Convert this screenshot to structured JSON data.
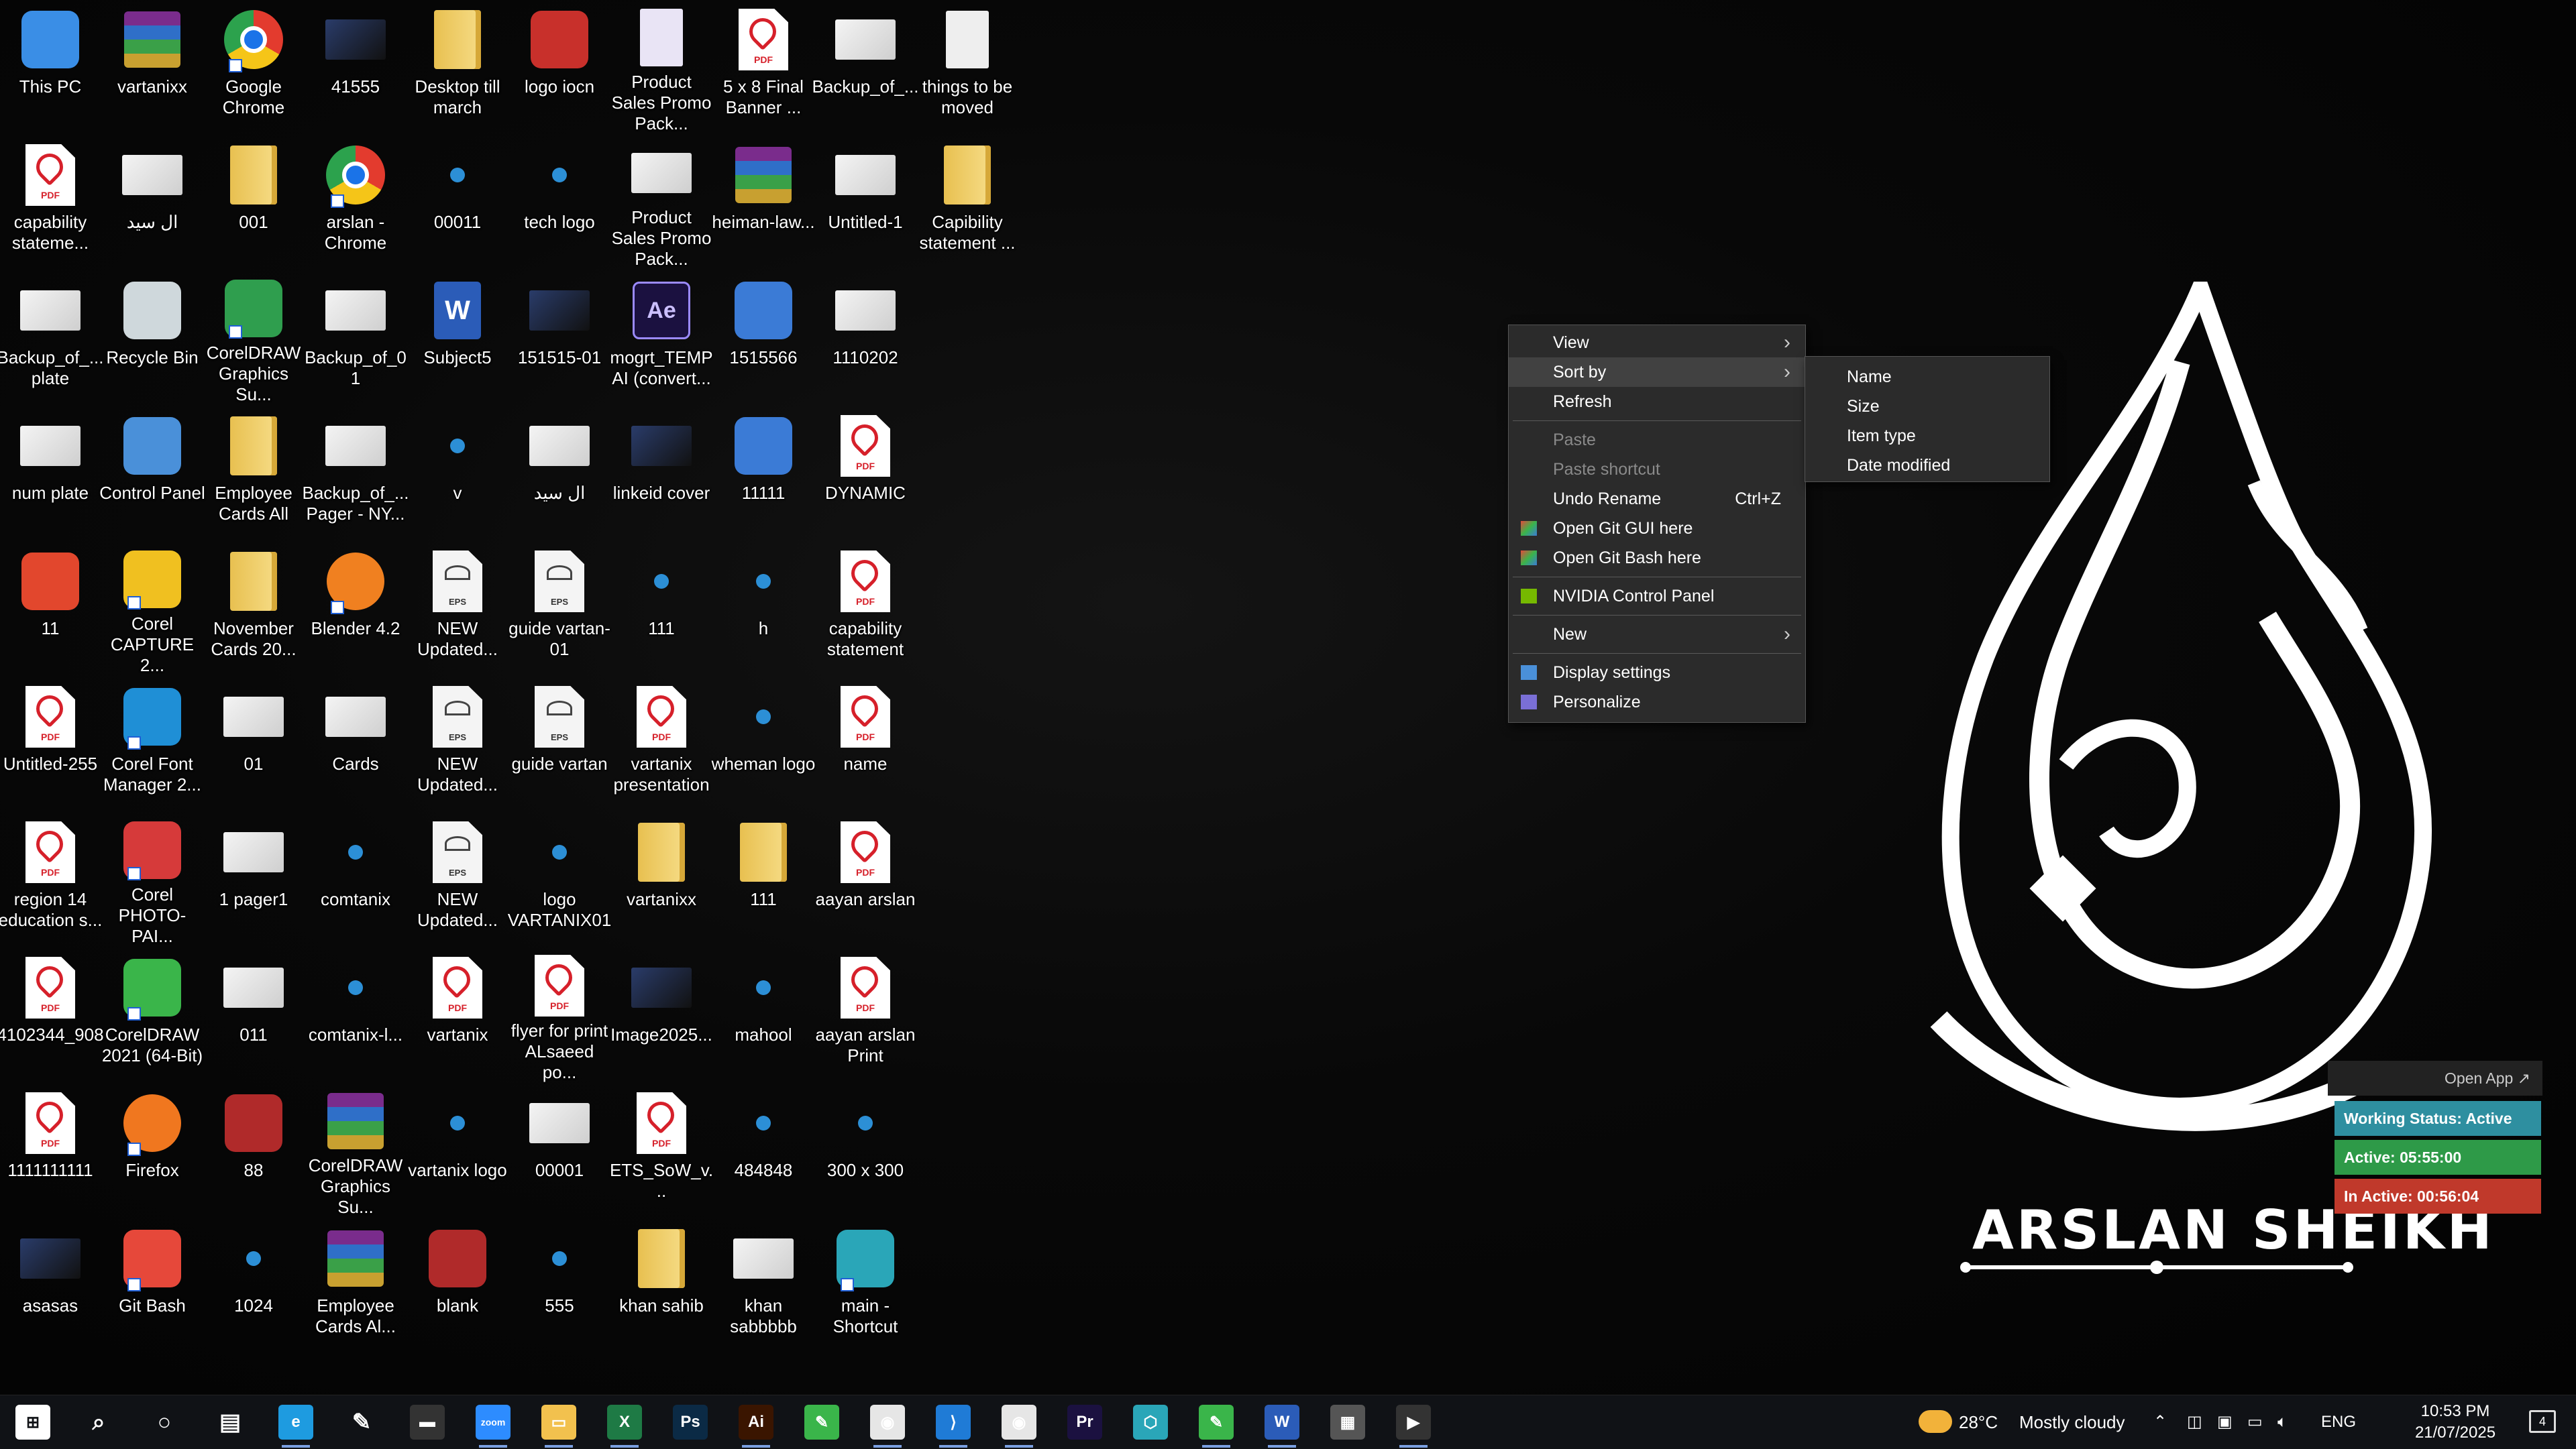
{
  "desktop_icons": [
    {
      "label": "This PC",
      "kind": "pc"
    },
    {
      "label": "vartanixx",
      "kind": "rar"
    },
    {
      "label": "Google Chrome",
      "kind": "chrome",
      "shortcut": true
    },
    {
      "label": "41555",
      "kind": "imgdark"
    },
    {
      "label": "Desktop till march",
      "kind": "folder"
    },
    {
      "label": "logo iocn",
      "kind": "logo"
    },
    {
      "label": "Product Sales Promo Pack...",
      "kind": "doc"
    },
    {
      "label": "5 x 8 Final Banner ...",
      "kind": "pdf"
    },
    {
      "label": "Backup_of_...",
      "kind": "img"
    },
    {
      "label": "things to be moved",
      "kind": "blank"
    },
    {
      "label": "capability stateme...",
      "kind": "pdf"
    },
    {
      "label": "ال سيد",
      "kind": "img"
    },
    {
      "label": "001",
      "kind": "folder"
    },
    {
      "label": "arslan - Chrome",
      "kind": "chrome",
      "shortcut": true
    },
    {
      "label": "00011",
      "kind": "small"
    },
    {
      "label": "tech logo",
      "kind": "small"
    },
    {
      "label": "Product Sales Promo Pack...",
      "kind": "img"
    },
    {
      "label": "heiman-law...",
      "kind": "rar"
    },
    {
      "label": "Untitled-1",
      "kind": "img"
    },
    {
      "label": "Capibility statement ...",
      "kind": "folder"
    },
    {
      "label": "Backup_of_... plate",
      "kind": "img"
    },
    {
      "label": "Recycle Bin",
      "kind": "bin"
    },
    {
      "label": "CorelDRAW Graphics Su...",
      "kind": "corel",
      "shortcut": true
    },
    {
      "label": "Backup_of_01",
      "kind": "img"
    },
    {
      "label": "Subject5",
      "kind": "word"
    },
    {
      "label": "151515-01",
      "kind": "imgdark"
    },
    {
      "label": "mogrt_TEMP AI (convert...",
      "kind": "ae"
    },
    {
      "label": "1515566",
      "kind": "scale"
    },
    {
      "label": "1110202",
      "kind": "img"
    },
    {
      "label": "num plate",
      "kind": "img"
    },
    {
      "label": "Control Panel",
      "kind": "cpanel"
    },
    {
      "label": "Employee Cards All",
      "kind": "folder"
    },
    {
      "label": "Backup_of_... Pager - NY...",
      "kind": "img"
    },
    {
      "label": "v",
      "kind": "small"
    },
    {
      "label": "ال سيد",
      "kind": "img"
    },
    {
      "label": "linkeid cover",
      "kind": "imgdark"
    },
    {
      "label": "11111",
      "kind": "scale"
    },
    {
      "label": "DYNAMIC",
      "kind": "pdf"
    },
    {
      "label": "11",
      "kind": "dots"
    },
    {
      "label": "Corel CAPTURE 2...",
      "kind": "capture",
      "shortcut": true
    },
    {
      "label": "November Cards 20...",
      "kind": "folder"
    },
    {
      "label": "Blender 4.2",
      "kind": "blender",
      "shortcut": true
    },
    {
      "label": "NEW Updated...",
      "kind": "eps"
    },
    {
      "label": "guide vartan-01",
      "kind": "eps"
    },
    {
      "label": "111",
      "kind": "small"
    },
    {
      "label": "h",
      "kind": "small"
    },
    {
      "label": "capability statement",
      "kind": "pdf"
    },
    {
      "label": "Untitled-255",
      "kind": "pdf"
    },
    {
      "label": "Corel Font Manager 2...",
      "kind": "font",
      "shortcut": true
    },
    {
      "label": "01",
      "kind": "img"
    },
    {
      "label": "Cards",
      "kind": "img"
    },
    {
      "label": "NEW Updated...",
      "kind": "eps"
    },
    {
      "label": "guide vartan",
      "kind": "eps"
    },
    {
      "label": "vartanix presentation",
      "kind": "pdf"
    },
    {
      "label": "wheman logo",
      "kind": "small"
    },
    {
      "label": "name",
      "kind": "pdf"
    },
    {
      "label": "region 14 education s...",
      "kind": "pdf"
    },
    {
      "label": "Corel PHOTO-PAI...",
      "kind": "photopaint",
      "shortcut": true
    },
    {
      "label": "1 pager1",
      "kind": "img"
    },
    {
      "label": "comtanix",
      "kind": "small"
    },
    {
      "label": "NEW Updated...",
      "kind": "eps"
    },
    {
      "label": "logo VARTANIX01",
      "kind": "small"
    },
    {
      "label": "vartanixx",
      "kind": "folder"
    },
    {
      "label": "111",
      "kind": "folder"
    },
    {
      "label": "aayan arslan",
      "kind": "pdf"
    },
    {
      "label": "4102344_908",
      "kind": "pdf"
    },
    {
      "label": "CorelDRAW 2021 (64-Bit)",
      "kind": "cdr",
      "shortcut": true
    },
    {
      "label": "011",
      "kind": "img"
    },
    {
      "label": "comtanix-l...",
      "kind": "small"
    },
    {
      "label": "vartanix",
      "kind": "pdf"
    },
    {
      "label": "flyer for print ALsaeed po...",
      "kind": "pdf"
    },
    {
      "label": "Image2025...",
      "kind": "imgdark"
    },
    {
      "label": "mahool",
      "kind": "small"
    },
    {
      "label": "aayan arslan Print",
      "kind": "pdf"
    },
    {
      "label": "1111111111",
      "kind": "pdf"
    },
    {
      "label": "Firefox",
      "kind": "firefox",
      "shortcut": true
    },
    {
      "label": "88",
      "kind": "imgred"
    },
    {
      "label": "CorelDRAW Graphics Su...",
      "kind": "rar"
    },
    {
      "label": "vartanix logo",
      "kind": "small"
    },
    {
      "label": "00001",
      "kind": "img"
    },
    {
      "label": "ETS_SoW_v...",
      "kind": "pdf"
    },
    {
      "label": "484848",
      "kind": "small"
    },
    {
      "label": "300 x 300",
      "kind": "small"
    },
    {
      "label": "asasas",
      "kind": "imgdark"
    },
    {
      "label": "Git Bash",
      "kind": "git",
      "shortcut": true
    },
    {
      "label": "1024",
      "kind": "small"
    },
    {
      "label": "Employee Cards Al...",
      "kind": "rar"
    },
    {
      "label": "blank",
      "kind": "imgred"
    },
    {
      "label": "555",
      "kind": "small"
    },
    {
      "label": "khan sahib",
      "kind": "folder"
    },
    {
      "label": "khan sabbbbb",
      "kind": "img"
    },
    {
      "label": "main - Shortcut",
      "kind": "hex",
      "shortcut": true
    }
  ],
  "context_menu": {
    "items": [
      {
        "label": "View",
        "submenu": true
      },
      {
        "label": "Sort by",
        "submenu": true,
        "highlighted": true
      },
      {
        "label": "Refresh"
      },
      {
        "separator": true
      },
      {
        "label": "Paste",
        "disabled": true
      },
      {
        "label": "Paste shortcut",
        "disabled": true
      },
      {
        "label": "Undo Rename",
        "shortcut": "Ctrl+Z"
      },
      {
        "label": "Open Git GUI here",
        "icon": "git-icon"
      },
      {
        "label": "Open Git Bash here",
        "icon": "git-icon"
      },
      {
        "separator": true
      },
      {
        "label": "NVIDIA Control Panel",
        "icon": "nvidia-icon"
      },
      {
        "separator": true
      },
      {
        "label": "New",
        "submenu": true
      },
      {
        "separator": true
      },
      {
        "label": "Display settings",
        "icon": "display-icon"
      },
      {
        "label": "Personalize",
        "icon": "personalize-icon"
      }
    ],
    "sort_submenu": [
      "Name",
      "Size",
      "Item type",
      "Date modified"
    ]
  },
  "wallpaper": {
    "signature": "ARSLAN SHEIKH"
  },
  "tracker": {
    "open_app": "Open App ↗",
    "status": "Working Status: Active",
    "active": "Active: 05:55:00",
    "inactive": "In Active: 00:56:04",
    "colors": {
      "status": "#2e8fa0",
      "active": "#2e9a48",
      "inactive": "#c0392b"
    }
  },
  "taskbar": {
    "apps": [
      "start",
      "search",
      "cortana",
      "task-view",
      "edge",
      "pen",
      "terminal",
      "zoom",
      "file-explorer",
      "excel",
      "photoshop",
      "illustrator",
      "coreldraw",
      "chrome",
      "vscode",
      "chrome-profile",
      "premiere",
      "hex-app",
      "coreldraw-2",
      "word",
      "calculator",
      "media-player"
    ],
    "weather": {
      "temp": "28°C",
      "desc": "Mostly cloudy"
    },
    "lang": "ENG",
    "time": "10:53 PM",
    "date": "21/07/2025",
    "notif_count": "4"
  }
}
